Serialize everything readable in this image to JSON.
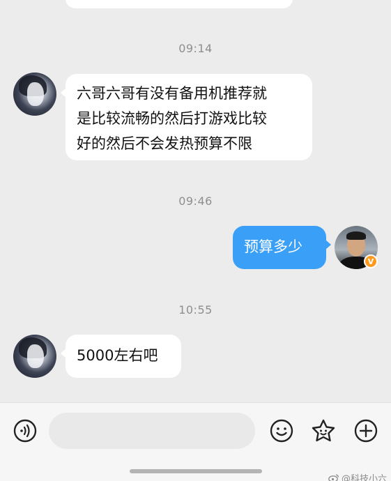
{
  "chat": {
    "timestamps": [
      "09:14",
      "09:46",
      "10:55"
    ],
    "messages": [
      {
        "from": "other",
        "text": "六哥六哥有没有备用机推荐就是比较流畅的然后打游戏比较好的然后不会发热预算不限"
      },
      {
        "from": "me",
        "text": "预算多少"
      },
      {
        "from": "other",
        "text": "5000左右吧"
      }
    ],
    "message_lines_1": [
      "六哥六哥有没有备用机推荐就",
      "是比较流畅的然后打游戏比较",
      "好的然后不会发热预算不限"
    ]
  },
  "me_avatar": {
    "badge": "V"
  },
  "input": {
    "value": ""
  },
  "icons": [
    "voice-icon",
    "emoji-icon",
    "sticker-icon",
    "plus-icon"
  ],
  "watermark": {
    "text": "@科技小六"
  },
  "colors": {
    "bubble_me": "#3aa0f7",
    "bubble_other": "#ffffff",
    "background": "#ececec",
    "badge": "#ff9a1f"
  }
}
